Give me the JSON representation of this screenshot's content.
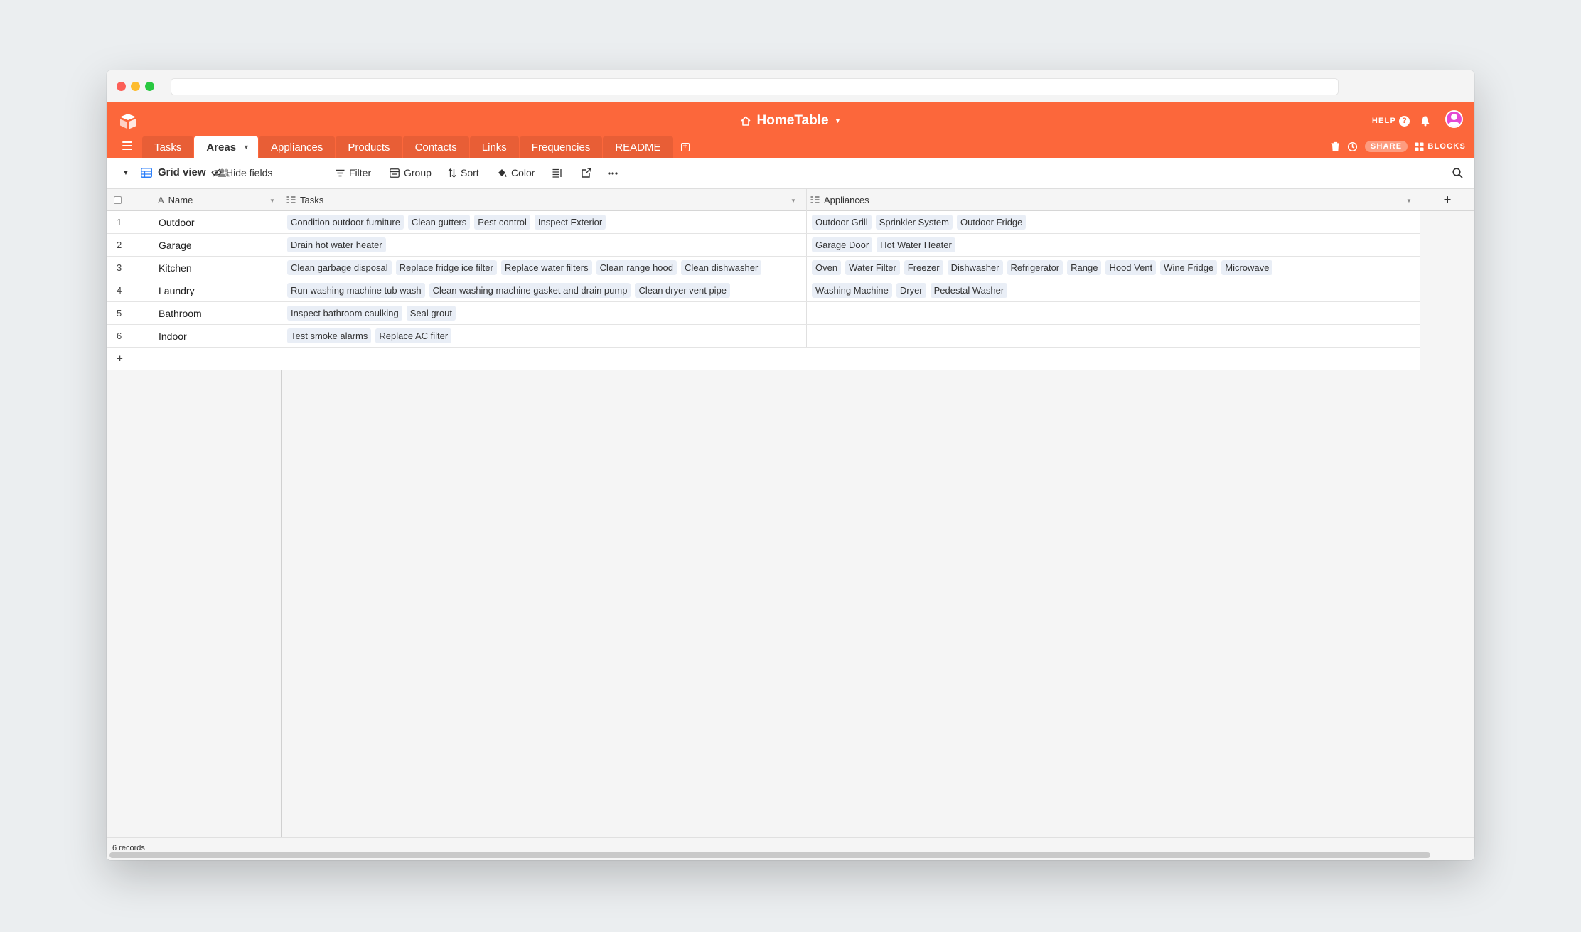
{
  "app": {
    "base_name": "HomeTable",
    "help_label": "HELP",
    "share_label": "SHARE",
    "blocks_label": "BLOCKS",
    "accent_color": "#fc673b"
  },
  "tables": [
    {
      "label": "Tasks"
    },
    {
      "label": "Areas",
      "active": true
    },
    {
      "label": "Appliances"
    },
    {
      "label": "Products"
    },
    {
      "label": "Contacts"
    },
    {
      "label": "Links"
    },
    {
      "label": "Frequencies"
    },
    {
      "label": "README"
    }
  ],
  "toolbar": {
    "view_name": "Grid view",
    "hide_fields": "Hide fields",
    "filter": "Filter",
    "group": "Group",
    "sort": "Sort",
    "color": "Color"
  },
  "columns": {
    "name": "Name",
    "tasks": "Tasks",
    "appliances": "Appliances"
  },
  "rows": [
    {
      "num": "1",
      "name": "Outdoor",
      "tasks": [
        "Condition outdoor furniture",
        "Clean gutters",
        "Pest control",
        "Inspect Exterior"
      ],
      "appliances": [
        "Outdoor Grill",
        "Sprinkler System",
        "Outdoor Fridge"
      ]
    },
    {
      "num": "2",
      "name": "Garage",
      "tasks": [
        "Drain hot water heater"
      ],
      "appliances": [
        "Garage Door",
        "Hot Water Heater"
      ]
    },
    {
      "num": "3",
      "name": "Kitchen",
      "tasks": [
        "Clean garbage disposal",
        "Replace fridge ice filter",
        "Replace water filters",
        "Clean range hood",
        "Clean dishwasher"
      ],
      "appliances": [
        "Oven",
        "Water Filter",
        "Freezer",
        "Dishwasher",
        "Refrigerator",
        "Range",
        "Hood Vent",
        "Wine Fridge",
        "Microwave"
      ]
    },
    {
      "num": "4",
      "name": "Laundry",
      "tasks": [
        "Run washing machine tub wash",
        "Clean washing machine gasket and drain pump",
        "Clean dryer vent pipe"
      ],
      "appliances": [
        "Washing Machine",
        "Dryer",
        "Pedestal Washer"
      ]
    },
    {
      "num": "5",
      "name": "Bathroom",
      "tasks": [
        "Inspect bathroom caulking",
        "Seal grout"
      ],
      "appliances": []
    },
    {
      "num": "6",
      "name": "Indoor",
      "tasks": [
        "Test smoke alarms",
        "Replace AC filter"
      ],
      "appliances": []
    }
  ],
  "add_row_label": "+",
  "add_column_label": "+",
  "footer": {
    "records": "6 records"
  }
}
